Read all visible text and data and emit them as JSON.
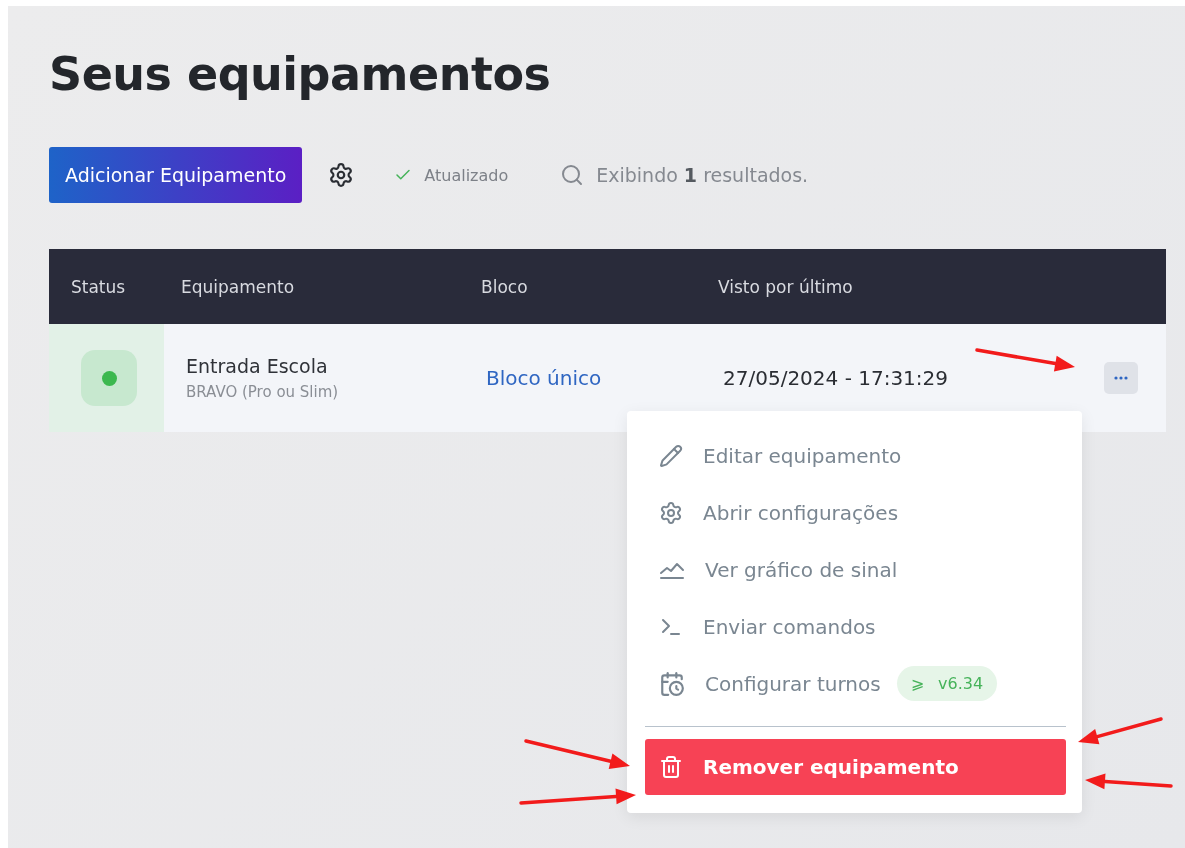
{
  "title": "Seus equipamentos",
  "toolbar": {
    "add_button": "Adicionar Equipamento",
    "sync_status": "Atualizado",
    "results": "Exibindo **1** resultados."
  },
  "table": {
    "columns": [
      "Status",
      "Equipamento",
      "Bloco",
      "Visto por último"
    ],
    "rows": [
      {
        "online": true,
        "name": "Entrada Escola",
        "model": "BRAVO (Pro ou Slim)",
        "block": "Bloco único",
        "last_seen": "27/05/2024 - 17:31:29",
        "menu_open": true
      }
    ]
  },
  "menu": {
    "items": [
      {
        "kind": "normal",
        "label": "Editar equipamento"
      },
      {
        "kind": "normal",
        "label": "Abrir configurações"
      },
      {
        "kind": "normal",
        "label": "Ver gráfico de sinal"
      },
      {
        "kind": "normal",
        "label": "Enviar comandos"
      },
      {
        "kind": "normal",
        "label": "Configurar turnos",
        "badge_symbol": "⩾",
        "badge": "v6.34"
      },
      {
        "kind": "danger",
        "label": "Remover equipamento"
      }
    ]
  }
}
